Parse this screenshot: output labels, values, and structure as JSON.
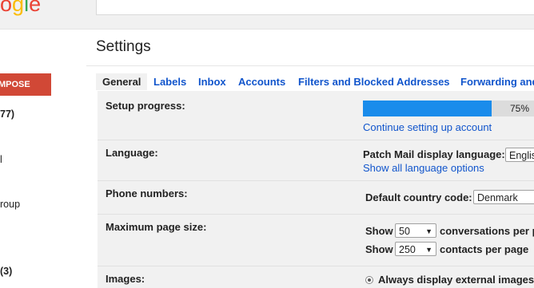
{
  "header": {
    "logo_text": "ogle",
    "search_value": ""
  },
  "sidebar": {
    "compose_label": "MPOSE",
    "items": [
      {
        "label": "77)",
        "bold": true
      },
      {
        "label": "l",
        "bold": false
      },
      {
        "label": "roup",
        "bold": false
      },
      {
        "label": "(3)",
        "bold": true
      }
    ]
  },
  "page": {
    "title": "Settings"
  },
  "tabs": [
    "General",
    "Labels",
    "Inbox",
    "Accounts",
    "Filters and Blocked Addresses",
    "Forwarding and"
  ],
  "settings": {
    "setup": {
      "label": "Setup progress:",
      "progress_percent": 75,
      "progress_text": "75%",
      "link": "Continue setting up account"
    },
    "language": {
      "label": "Language:",
      "prefix": "Patch Mail display language:",
      "value": "Englis",
      "link": "Show all language options"
    },
    "phone": {
      "label": "Phone numbers:",
      "prefix": "Default country code:",
      "value": "Denmark"
    },
    "page_size": {
      "label": "Maximum page size:",
      "show_label": "Show",
      "conversations_value": "50",
      "conversations_suffix": "conversations per p",
      "contacts_value": "250",
      "contacts_suffix": "contacts per page"
    },
    "images": {
      "label": "Images:",
      "option": "Always display external images"
    }
  },
  "colors": {
    "compose": "#d14836",
    "progress": "#1a8ceb",
    "link": "#1155cc"
  }
}
